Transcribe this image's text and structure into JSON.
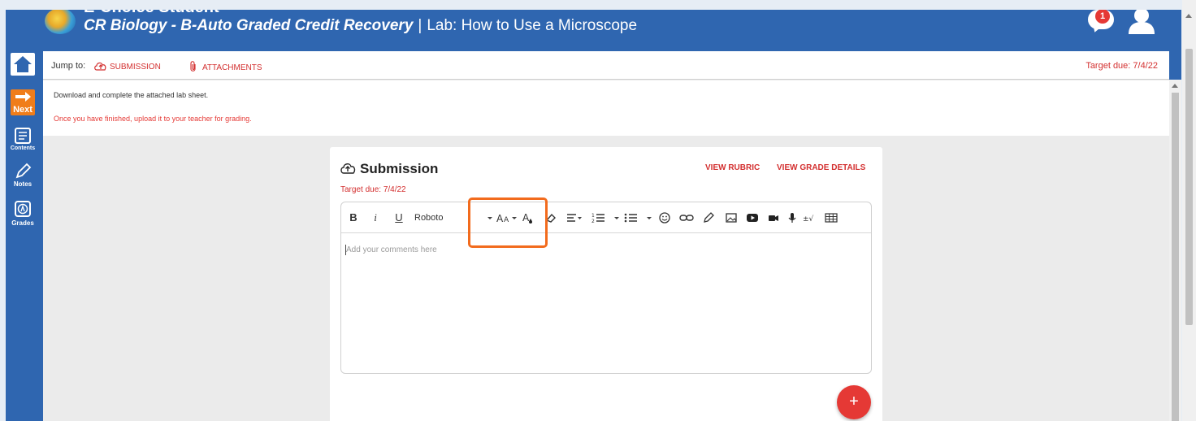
{
  "header": {
    "app_name": "E-Choice Student",
    "course": "CR Biology - B-Auto Graded Credit Recovery",
    "separator": "|",
    "page": "Lab: How to Use a Microscope",
    "message_count": "1"
  },
  "rail": {
    "next_label": "Next",
    "contents_label": "Contents",
    "notes_label": "Notes",
    "grades_label": "Grades"
  },
  "jumpbar": {
    "label": "Jump to:",
    "submission_link": "SUBMISSION",
    "attachments_link": "ATTACHMENTS",
    "target_due": "Target due: 7/4/22"
  },
  "instructions": {
    "line1": "Download and complete the attached lab sheet.",
    "line2": "Once you have finished, upload it to your teacher for grading."
  },
  "submission": {
    "title": "Submission",
    "view_rubric": "VIEW RUBRIC",
    "view_grade_details": "VIEW GRADE DETAILS",
    "target_due": "Target due: 7/4/22",
    "editor": {
      "font_name": "Roboto",
      "placeholder": "Add your comments here"
    },
    "fab_label": "+"
  },
  "colors": {
    "brand_blue": "#2f66b0",
    "accent_red": "#d32f2f",
    "next_orange": "#f07d1a",
    "highlight_orange": "#f26b1d"
  }
}
